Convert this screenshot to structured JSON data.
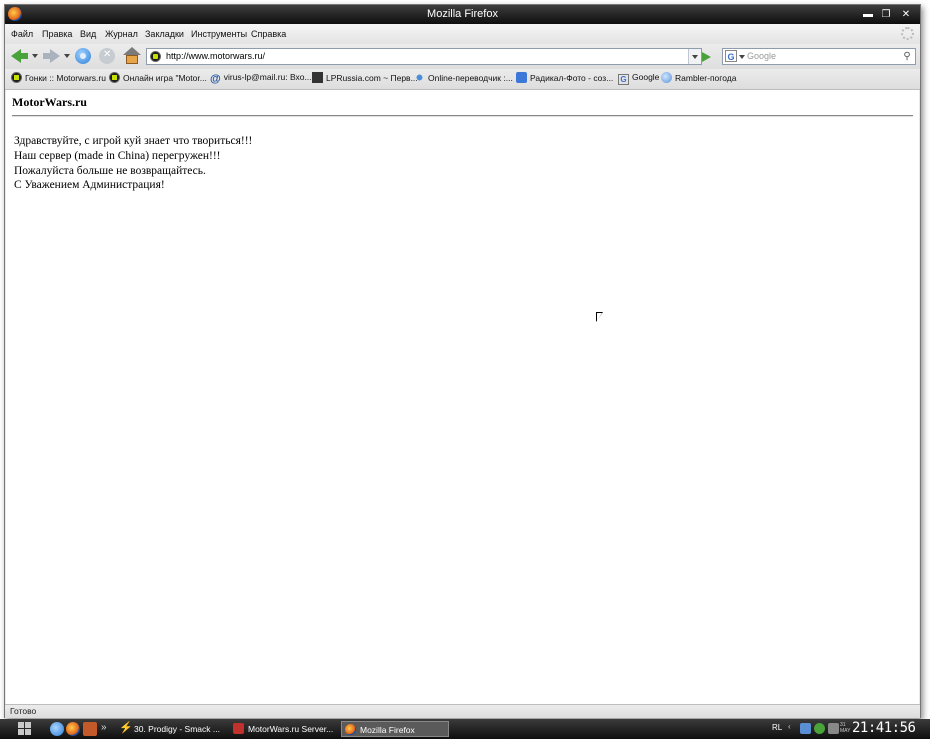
{
  "window": {
    "title": "Mozilla Firefox"
  },
  "menu": [
    "Файл",
    "Правка",
    "Вид",
    "Журнал",
    "Закладки",
    "Инструменты",
    "Справка"
  ],
  "nav": {
    "url": "http://www.motorwars.ru/",
    "search_placeholder": "Google"
  },
  "bookmarks": [
    {
      "label": "Гонки :: Motorwars.ru",
      "icon": "motorwars-icon"
    },
    {
      "label": "Онлайн игра \"Motor...",
      "icon": "motorwars-icon"
    },
    {
      "label": "virus-lp@mail.ru: Вхо...",
      "icon": "mailru-at-icon"
    },
    {
      "label": "LPRussia.com ~ Перв...",
      "icon": "lprussia-icon"
    },
    {
      "label": "Online-переводчик :...",
      "icon": "translator-icon"
    },
    {
      "label": "Радикал-Фото - соз...",
      "icon": "radikal-icon"
    },
    {
      "label": "Google",
      "icon": "google-icon"
    },
    {
      "label": "Rambler-погода",
      "icon": "rambler-icon"
    }
  ],
  "page": {
    "site_title": "MotorWars.ru",
    "lines": [
      "Здравствуйте, с игрой куй знает что твориться!!!",
      "Наш сервер (made in China) перегружен!!!",
      "Пожалуйста больше не возвращайтесь.",
      "С Уважением Администрация!"
    ]
  },
  "status": {
    "text": "Готово"
  },
  "taskbar": {
    "tasks": [
      {
        "label": "30. Prodigy - Smack ...",
        "icon": "winamp-bolt-icon"
      },
      {
        "label": "MotorWars.ru Server...",
        "icon": "motorwars-red-icon"
      },
      {
        "label": "Mozilla Firefox",
        "icon": "firefox-icon"
      }
    ],
    "tray_lang": "RL",
    "clock": "21:41:56",
    "date_day": "31",
    "date_month": "MAY"
  },
  "colors": {
    "title_bar": "#1a1a1a",
    "go_green": "#4aa23a",
    "back_green": "#4aa23a"
  }
}
